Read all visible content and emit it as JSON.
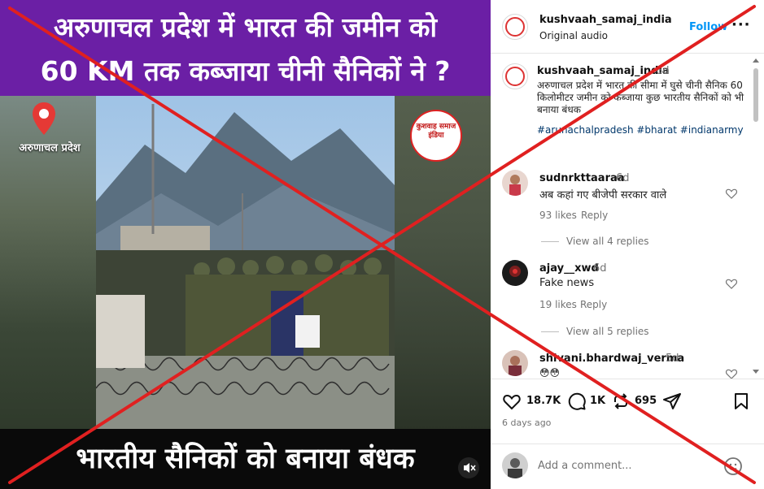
{
  "video": {
    "title_line1": "अरुणाचल प्रदेश में भारत की जमीन को",
    "title_line2": "60 KM तक कब्जाया चीनी सैनिकों ने ?",
    "location_label": "अरुणाचल प्रदेश",
    "logo_text": "कुशवाह समाज इंडिया",
    "bottom_caption": "भारतीय सैनिकों को बनाया बंधक",
    "mute_icon": "speaker-muted-icon"
  },
  "post_header": {
    "username": "kushvaah_samaj_india",
    "audio": "Original audio",
    "follow_label": "Follow",
    "more_label": "···"
  },
  "caption": {
    "username": "kushvaah_samaj_india",
    "age": "6d",
    "text": "अरुणाचल प्रदेश में भारत की सीमा में घुसे चीनी सैनिक 60 किलोमीटर जमीन को कब्जाया कुछ भारतीय सैनिकों को भी बनाया बंधक",
    "hashtags": "#arunachalpradesh #bharat #indianarmy"
  },
  "comments": [
    {
      "username": "sudnrkttaaraa",
      "age": "6d",
      "text": "अब कहां गए बीजेपी सरकार वाले",
      "likes": "93 likes",
      "reply_label": "Reply",
      "view_replies": "View all 4 replies"
    },
    {
      "username": "ajay__xwd",
      "age": "6d",
      "text": "Fake news",
      "likes": "19 likes",
      "reply_label": "Reply",
      "view_replies": "View all 5 replies"
    },
    {
      "username": "shivani.bhardwaj_verma",
      "age": "5d",
      "text": "😳😳"
    }
  ],
  "actions": {
    "likes": "18.7K",
    "comments": "1K",
    "reposts": "695",
    "posted_ago": "6 days ago"
  },
  "add_comment": {
    "placeholder": "Add a comment..."
  },
  "colors": {
    "title_band": "#6b1fa5",
    "follow": "#0095f6",
    "hashtag": "#00376b",
    "overlay_x": "#e02020"
  }
}
